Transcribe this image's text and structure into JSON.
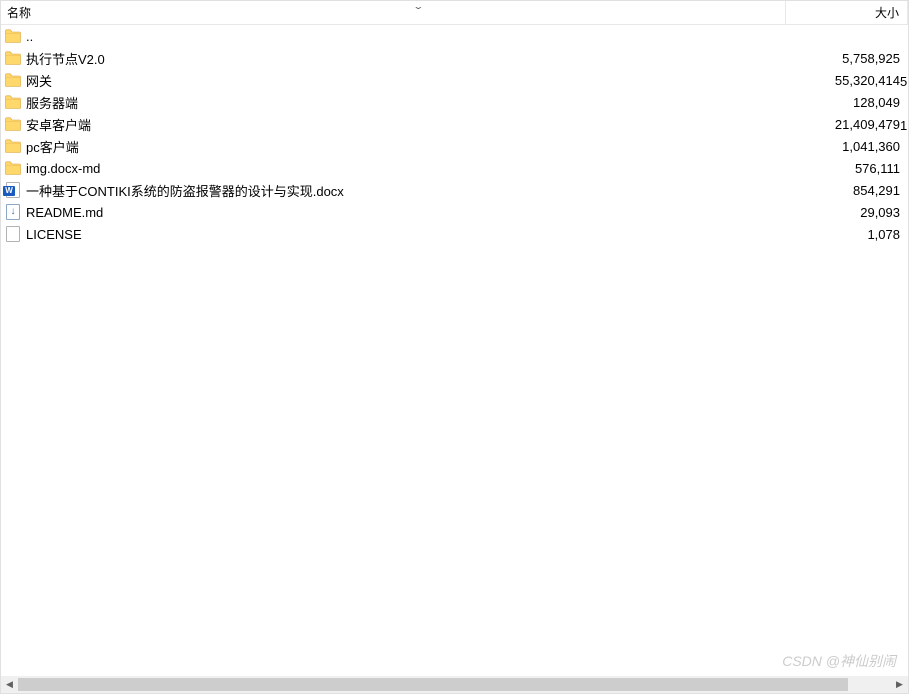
{
  "columns": {
    "name": "名称",
    "size": "大小"
  },
  "sort_indicator": "⌄",
  "rows": [
    {
      "type": "folder",
      "name": "..",
      "size": ""
    },
    {
      "type": "folder",
      "name": "执行节点V2.0",
      "size": "5,758,925"
    },
    {
      "type": "folder",
      "name": "网关",
      "size": "55,320,414"
    },
    {
      "type": "folder",
      "name": "服务器端",
      "size": "128,049"
    },
    {
      "type": "folder",
      "name": "安卓客户端",
      "size": "21,409,479"
    },
    {
      "type": "folder",
      "name": "pc客户端",
      "size": "1,041,360"
    },
    {
      "type": "folder",
      "name": "img.docx-md",
      "size": "576,111"
    },
    {
      "type": "docx",
      "name": "一种基于CONTIKI系统的防盗报警器的设计与实现.docx",
      "size": "854,291"
    },
    {
      "type": "md",
      "name": "README.md",
      "size": "29,093"
    },
    {
      "type": "blank",
      "name": "LICENSE",
      "size": "1,078"
    }
  ],
  "partial_third_column": [
    "",
    "",
    "5",
    "",
    "1",
    "",
    "",
    "",
    "",
    ""
  ],
  "scrollbar": {
    "left_arrow": "◀",
    "right_arrow": "▶"
  },
  "watermark": "CSDN @神仙别闹"
}
